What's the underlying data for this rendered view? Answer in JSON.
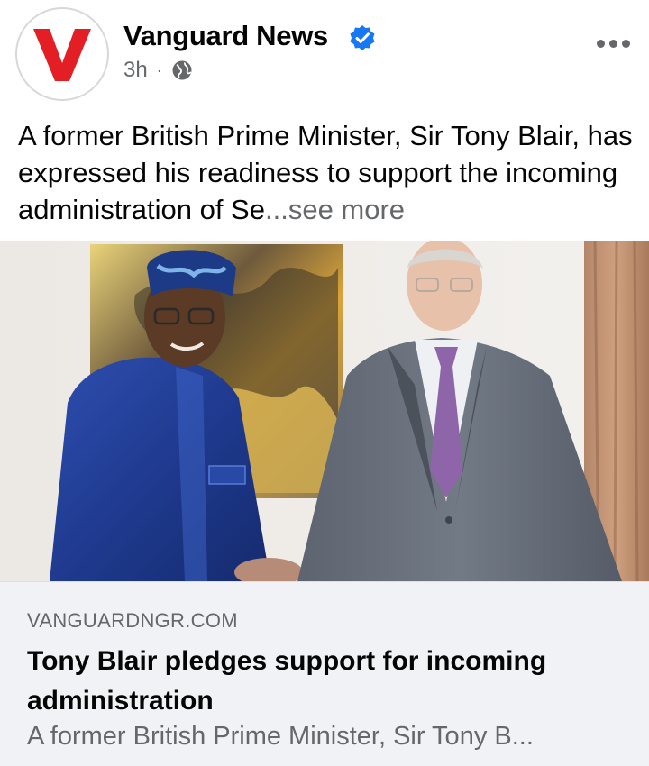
{
  "post": {
    "page_name": "Vanguard News",
    "time": "3h",
    "separator": "·",
    "text": "A former British Prime Minister, Sir Tony Blair, has expressed his readiness to support the incoming administration of Se",
    "see_more": "...see more",
    "icons": {
      "avatar": "vanguard-v-logo",
      "verified": "verified-badge-icon",
      "audience": "globe-icon",
      "more": "more-options-icon"
    },
    "colors": {
      "brand_red": "#e31e24",
      "verified_blue": "#1877f2",
      "secondary_text": "#65676b"
    }
  },
  "link_preview": {
    "domain": "VANGUARDNGR.COM",
    "headline": "Tony Blair pledges support for incoming administration",
    "snippet": "A former British Prime Minister, Sir Tony B..."
  }
}
